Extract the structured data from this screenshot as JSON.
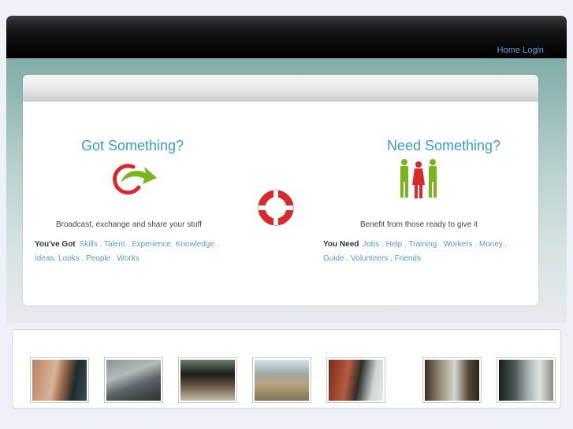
{
  "nav": {
    "home": "Home",
    "login": "Login"
  },
  "left": {
    "heading": "Got Something?",
    "tagline": "Broadcast, exchange and share your stuff",
    "label": "You've Got",
    "links_row1": [
      "Skills",
      "Talent",
      "Experience",
      "Knowledge"
    ],
    "links_row2": [
      "Ideas",
      "Looks",
      "People",
      "Works"
    ]
  },
  "right": {
    "heading": "Need Something?",
    "tagline": "Benefit from those ready to give it",
    "label": "You Need",
    "links_row1": [
      "Jobs",
      "Help",
      "Training",
      "Workers",
      "Money"
    ],
    "links_row2": [
      "Guide",
      "Volunteers",
      "Friends"
    ]
  },
  "icons": {
    "arrow": "circular-arrow-icon",
    "people": "people-icon",
    "center": "lifebuoy-icon"
  },
  "colors": {
    "heading": "#3a9ccc",
    "link": "#5a9ec4",
    "accent_red": "#d8292d",
    "accent_green": "#7ab51d"
  },
  "gallery": {
    "thumbnails": [
      "thumbnail-1",
      "thumbnail-2",
      "thumbnail-3",
      "thumbnail-4",
      "thumbnail-5",
      "thumbnail-6",
      "thumbnail-7"
    ]
  }
}
